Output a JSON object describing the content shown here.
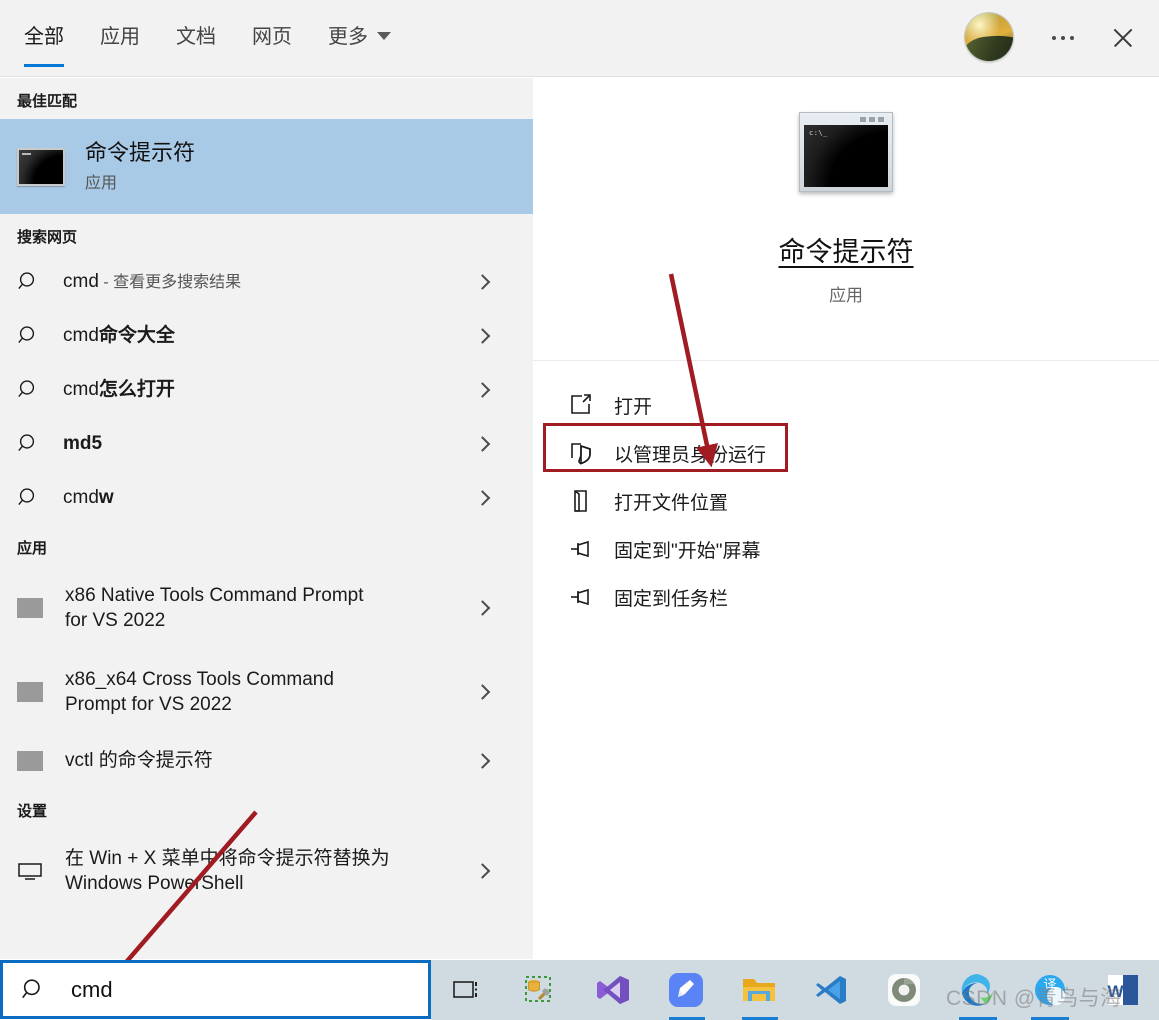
{
  "header": {
    "tabs": [
      {
        "label": "全部",
        "active": true
      },
      {
        "label": "应用",
        "active": false
      },
      {
        "label": "文档",
        "active": false
      },
      {
        "label": "网页",
        "active": false
      },
      {
        "label": "更多",
        "active": false
      }
    ],
    "avatar_name": "user-avatar",
    "more_label": "…",
    "close_label": "✕",
    "accent_color": "#0078d7"
  },
  "left": {
    "best_match": {
      "section": "最佳匹配",
      "title": "命令提示符",
      "subtitle": "应用",
      "selected_bg": "#a9cae7"
    },
    "web_section": "搜索网页",
    "web_results": [
      {
        "plain": "cmd",
        "bold": "",
        "suffix": " - 查看更多搜索结果"
      },
      {
        "plain": "cmd",
        "bold": "命令大全",
        "suffix": ""
      },
      {
        "plain": "cmd",
        "bold": "怎么打开",
        "suffix": ""
      },
      {
        "plain": "",
        "bold": "md5",
        "suffix": ""
      },
      {
        "plain": "cmd",
        "bold": "w",
        "suffix": ""
      }
    ],
    "apps_section": "应用",
    "apps": [
      {
        "label": "x86 Native Tools Command Prompt for VS 2022"
      },
      {
        "label": "x86_x64 Cross Tools Command Prompt for VS 2022"
      },
      {
        "label": "vctl 的命令提示符"
      }
    ],
    "settings_section": "设置",
    "settings": [
      {
        "label": "在 Win + X 菜单中将命令提示符替换为 Windows PowerShell"
      }
    ]
  },
  "preview": {
    "icon_prompt": "c:\\_",
    "title": "命令提示符",
    "subtitle": "应用",
    "actions": [
      {
        "label": "打开",
        "icon": "open-icon",
        "highlighted": false
      },
      {
        "label": "以管理员身份运行",
        "icon": "shield-icon",
        "highlighted": true
      },
      {
        "label": "打开文件位置",
        "icon": "folder-icon",
        "highlighted": false
      },
      {
        "label": "固定到\"开始\"屏幕",
        "icon": "pin-icon",
        "highlighted": false
      },
      {
        "label": "固定到任务栏",
        "icon": "pin-icon",
        "highlighted": false
      }
    ],
    "highlight_color": "#a01b22"
  },
  "search": {
    "value": "cmd",
    "icon": "search-icon",
    "border_color": "#0a6cc1"
  },
  "taskbar": {
    "items": [
      {
        "name": "task-view-icon"
      },
      {
        "name": "sql-tools-icon"
      },
      {
        "name": "visual-studio-icon"
      },
      {
        "name": "pen-app-icon"
      },
      {
        "name": "file-explorer-icon"
      },
      {
        "name": "vscode-icon"
      },
      {
        "name": "chrome-icon"
      },
      {
        "name": "edge-icon"
      },
      {
        "name": "translate-icon"
      },
      {
        "name": "word-icon"
      }
    ]
  },
  "watermark": {
    "text": "CSDN @青鸟与海"
  }
}
